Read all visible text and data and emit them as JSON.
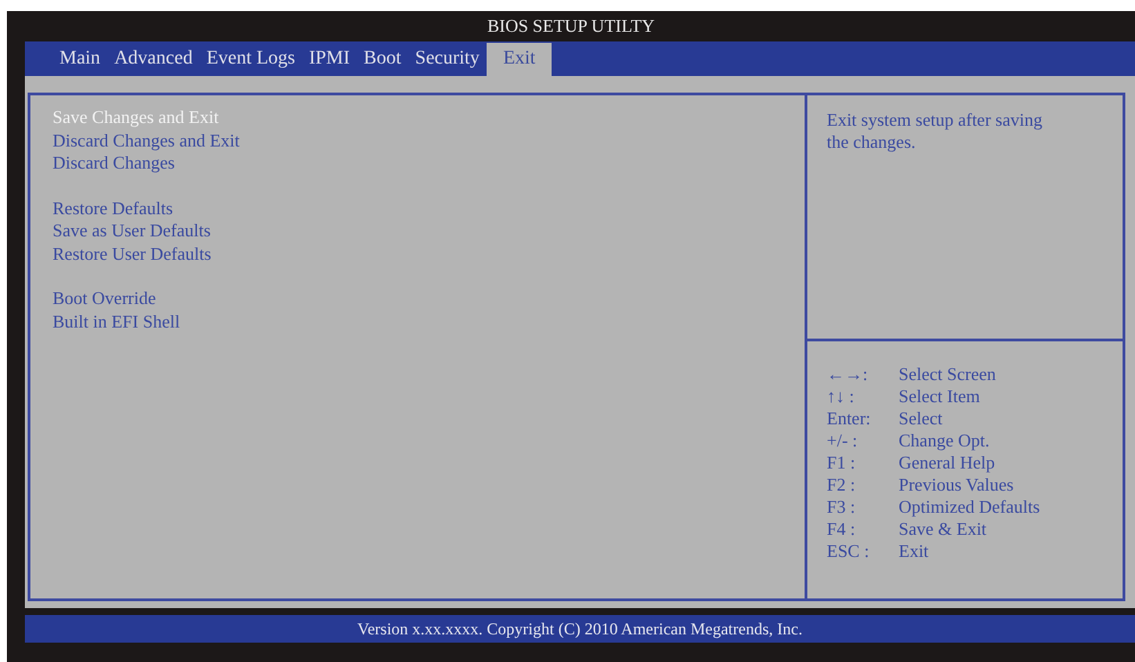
{
  "window": {
    "title": "BIOS SETUP UTILTY"
  },
  "tabs": [
    {
      "label": "Main",
      "selected": false
    },
    {
      "label": "Advanced",
      "selected": false
    },
    {
      "label": "Event Logs",
      "selected": false
    },
    {
      "label": "IPMI",
      "selected": false
    },
    {
      "label": "Boot",
      "selected": false
    },
    {
      "label": "Security",
      "selected": false
    },
    {
      "label": "Exit",
      "selected": true
    }
  ],
  "menu_groups": [
    [
      {
        "label": "Save Changes and Exit",
        "selected": true
      },
      {
        "label": "Discard Changes and Exit",
        "selected": false
      },
      {
        "label": "Discard Changes",
        "selected": false
      }
    ],
    [
      {
        "label": "Restore Defaults",
        "selected": false
      },
      {
        "label": "Save as User Defaults",
        "selected": false
      },
      {
        "label": "Restore User Defaults",
        "selected": false
      }
    ],
    [
      {
        "label": "Boot Override",
        "selected": false
      },
      {
        "label": "Built in EFI Shell",
        "selected": false
      }
    ]
  ],
  "help_text": "Exit system setup after saving the changes.",
  "keys": [
    {
      "key": "←→:",
      "action": "Select Screen"
    },
    {
      "key": "↑↓ :",
      "action": "Select Item"
    },
    {
      "key": "Enter:",
      "action": "Select"
    },
    {
      "key": "+/- :",
      "action": "Change Opt."
    },
    {
      "key": "F1 :",
      "action": "General Help"
    },
    {
      "key": "F2 :",
      "action": "Previous Values"
    },
    {
      "key": "F3 :",
      "action": "Optimized Defaults"
    },
    {
      "key": "F4 :",
      "action": "Save & Exit"
    },
    {
      "key": "ESC :",
      "action": "Exit"
    }
  ],
  "status_bar": "Version x.xx.xxxx. Copyright (C) 2010 American Megatrends, Inc."
}
